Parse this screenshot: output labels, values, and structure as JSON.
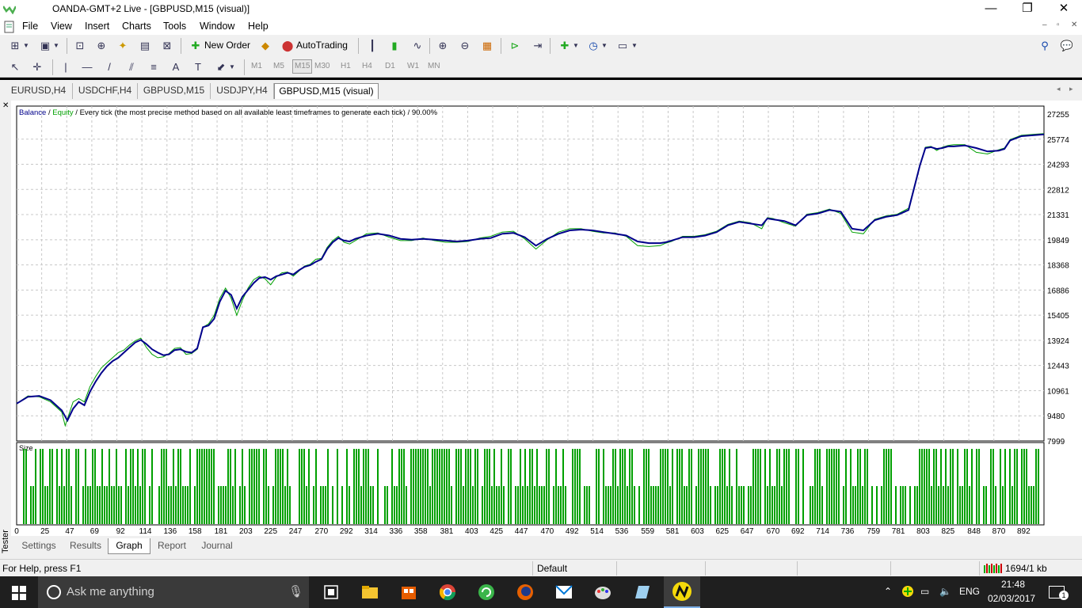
{
  "window": {
    "title": "OANDA-GMT+2 Live - [GBPUSD,M15 (visual)]",
    "minimize": "—",
    "maximize": "❐",
    "close": "✕"
  },
  "menu": {
    "items": [
      "File",
      "View",
      "Insert",
      "Charts",
      "Tools",
      "Window",
      "Help"
    ],
    "mdi": [
      "–",
      "▫",
      "✕"
    ]
  },
  "toolbar": {
    "new_order": "New Order",
    "autotrading": "AutoTrading"
  },
  "timeframes": [
    "M1",
    "M5",
    "M15",
    "M30",
    "H1",
    "H4",
    "D1",
    "W1",
    "MN"
  ],
  "active_timeframe": "M15",
  "chart_tabs": [
    "EURUSD,H4",
    "USDCHF,H4",
    "GBPUSD,M15",
    "USDJPY,H4",
    "GBPUSD,M15 (visual)"
  ],
  "active_chart_tab": "GBPUSD,M15 (visual)",
  "tester_tabs": [
    "Settings",
    "Results",
    "Graph",
    "Report",
    "Journal"
  ],
  "active_tester_tab": "Graph",
  "tester_label": "Tester",
  "status": {
    "help": "For Help, press F1",
    "profile": "Default",
    "traffic": "1694/1 kb"
  },
  "taskbar": {
    "search_placeholder": "Ask me anything",
    "lang": "ENG",
    "time": "21:48",
    "date": "02/03/2017",
    "notifications": "1"
  },
  "colors": {
    "balance": "#00008b",
    "equity": "#00a000",
    "size_bar": "#00a000"
  },
  "chart_data": {
    "type": "line",
    "legend": {
      "balance": "Balance",
      "sep1": " / ",
      "equity": "Equity",
      "desc": " / Every tick (the most precise method based on all available least timeframes to generate each tick) / 90.00%"
    },
    "size_label": "Size",
    "y_ticks": [
      27255,
      25774,
      24293,
      22812,
      21331,
      19849,
      18368,
      16886,
      15405,
      13924,
      12443,
      10961,
      9480,
      7999
    ],
    "ylim": [
      7999,
      27255
    ],
    "x_ticks": [
      0,
      25,
      47,
      69,
      92,
      114,
      136,
      158,
      181,
      203,
      225,
      247,
      270,
      292,
      314,
      336,
      358,
      381,
      403,
      425,
      447,
      470,
      492,
      514,
      536,
      559,
      581,
      603,
      625,
      647,
      670,
      692,
      714,
      736,
      759,
      781,
      803,
      825,
      848,
      870,
      892
    ],
    "xlim": [
      0,
      910
    ],
    "series": [
      {
        "name": "Balance",
        "x": [
          0,
          10,
          20,
          30,
          40,
          45,
          50,
          55,
          60,
          65,
          70,
          75,
          80,
          85,
          90,
          95,
          100,
          105,
          110,
          115,
          120,
          125,
          130,
          135,
          140,
          145,
          150,
          155,
          160,
          165,
          170,
          175,
          180,
          185,
          190,
          195,
          200,
          205,
          210,
          215,
          220,
          225,
          230,
          235,
          240,
          245,
          250,
          255,
          260,
          265,
          270,
          275,
          280,
          285,
          290,
          295,
          300,
          310,
          320,
          330,
          340,
          350,
          360,
          370,
          380,
          390,
          400,
          410,
          420,
          430,
          440,
          450,
          460,
          470,
          480,
          490,
          500,
          510,
          520,
          530,
          540,
          550,
          560,
          570,
          575,
          580,
          590,
          600,
          610,
          620,
          630,
          640,
          650,
          660,
          665,
          670,
          680,
          690,
          700,
          710,
          720,
          730,
          740,
          750,
          760,
          770,
          780,
          790,
          800,
          805,
          810,
          815,
          820,
          825,
          830,
          840,
          850,
          860,
          870,
          875,
          880,
          890,
          900,
          910
        ],
        "y": [
          10200,
          10600,
          10650,
          10400,
          9800,
          9200,
          9900,
          10300,
          10100,
          10900,
          11500,
          12000,
          12400,
          12700,
          12900,
          13200,
          13500,
          13800,
          13950,
          13700,
          13400,
          13200,
          13050,
          13100,
          13350,
          13400,
          13250,
          13200,
          13450,
          14700,
          14800,
          15200,
          16200,
          16850,
          16600,
          15800,
          16500,
          16900,
          17300,
          17600,
          17650,
          17500,
          17700,
          17800,
          17900,
          17800,
          18050,
          18250,
          18350,
          18550,
          18700,
          19300,
          19700,
          19950,
          19800,
          19750,
          19900,
          20100,
          20200,
          20100,
          19900,
          19850,
          19900,
          19850,
          19800,
          19750,
          19800,
          19900,
          19950,
          20200,
          20250,
          20000,
          19500,
          19900,
          20200,
          20400,
          20450,
          20400,
          20300,
          20200,
          20100,
          19750,
          19650,
          19650,
          19700,
          19800,
          20000,
          20000,
          20100,
          20300,
          20700,
          20900,
          20800,
          20700,
          21100,
          21050,
          20950,
          20700,
          21300,
          21400,
          21600,
          21500,
          20500,
          20400,
          21000,
          21200,
          21300,
          21600,
          24200,
          25250,
          25300,
          25200,
          25250,
          25350,
          25350,
          25400,
          25250,
          25050,
          25100,
          25200,
          25700,
          25950,
          26000,
          26050
        ]
      },
      {
        "name": "Equity",
        "x": [
          0,
          10,
          20,
          30,
          40,
          43,
          45,
          50,
          55,
          60,
          65,
          70,
          75,
          80,
          85,
          90,
          95,
          100,
          105,
          110,
          115,
          120,
          125,
          130,
          135,
          140,
          145,
          150,
          155,
          160,
          165,
          170,
          175,
          180,
          185,
          190,
          195,
          200,
          205,
          210,
          215,
          220,
          225,
          230,
          235,
          240,
          245,
          250,
          255,
          260,
          265,
          270,
          275,
          280,
          285,
          290,
          295,
          300,
          310,
          320,
          330,
          340,
          350,
          360,
          370,
          380,
          390,
          400,
          410,
          420,
          430,
          440,
          450,
          460,
          470,
          480,
          490,
          500,
          510,
          520,
          530,
          540,
          550,
          560,
          570,
          575,
          580,
          590,
          600,
          610,
          620,
          630,
          640,
          650,
          660,
          665,
          670,
          680,
          690,
          700,
          710,
          720,
          730,
          740,
          750,
          760,
          770,
          780,
          790,
          800,
          805,
          810,
          815,
          820,
          825,
          830,
          840,
          850,
          860,
          870,
          875,
          880,
          890,
          900,
          910
        ],
        "y": [
          10200,
          10650,
          10600,
          10300,
          9700,
          8900,
          9300,
          10300,
          10500,
          10300,
          11200,
          11800,
          12300,
          12600,
          12900,
          13200,
          13350,
          13650,
          13900,
          14050,
          13500,
          13100,
          12900,
          12950,
          13150,
          13450,
          13500,
          13100,
          13150,
          13400,
          14700,
          14900,
          15400,
          16400,
          17000,
          16400,
          15400,
          16300,
          17000,
          17500,
          17700,
          17550,
          17200,
          17650,
          17900,
          17950,
          17700,
          18000,
          18300,
          18400,
          18700,
          18750,
          19400,
          19800,
          20050,
          19700,
          19600,
          19800,
          20200,
          20250,
          20000,
          19800,
          19800,
          19950,
          19800,
          19700,
          19700,
          19750,
          19950,
          20050,
          20300,
          20350,
          19900,
          19300,
          19850,
          20300,
          20500,
          20500,
          20350,
          20250,
          20250,
          20050,
          19500,
          19450,
          19500,
          19650,
          19750,
          20050,
          20050,
          20150,
          20350,
          20750,
          20950,
          20850,
          20500,
          21150,
          21100,
          20850,
          20650,
          21350,
          21450,
          21650,
          21400,
          20300,
          20200,
          21050,
          21250,
          21350,
          21700,
          24250,
          25300,
          25350,
          25100,
          25300,
          25400,
          25450,
          25450,
          25000,
          24900,
          25150,
          25250,
          25750,
          26000,
          26050,
          26100
        ]
      }
    ],
    "grid": true
  }
}
